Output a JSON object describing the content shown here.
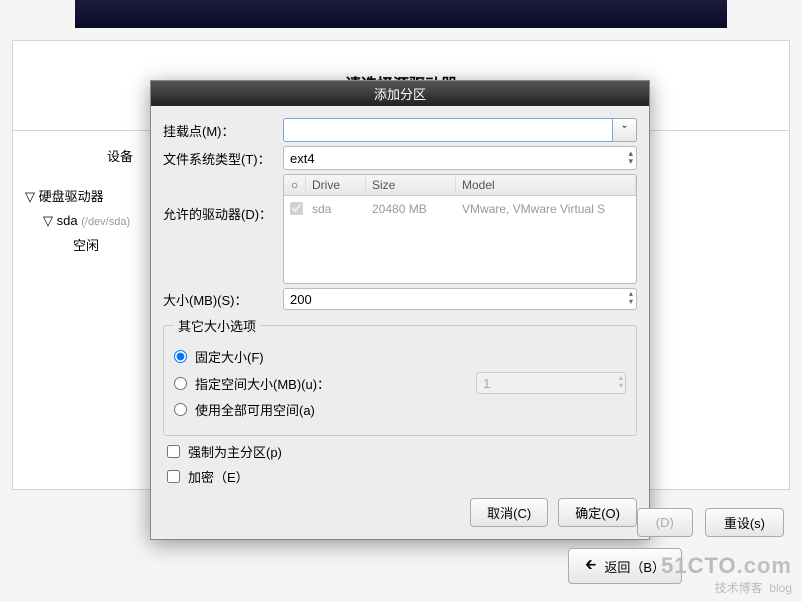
{
  "bg": {
    "title": "请选择源驱动器",
    "tree_header": "设备",
    "tree": {
      "root": "硬盘驱动器",
      "disk": "sda",
      "disk_path": "(/dev/sda)",
      "free": "空闲"
    }
  },
  "dialog": {
    "title": "添加分区",
    "mount_label": "挂载点(M)：",
    "mount_value": "",
    "fs_label": "文件系统类型(T)：",
    "fs_value": "ext4",
    "drives_label": "允许的驱动器(D)：",
    "drive_headers": {
      "drive": "Drive",
      "size": "Size",
      "model": "Model"
    },
    "drive_row": {
      "name": "sda",
      "size": "20480 MB",
      "model": "VMware, VMware Virtual S"
    },
    "size_label": "大小(MB)(S)：",
    "size_value": "200",
    "size_opts": {
      "legend": "其它大小选项",
      "fixed": "固定大小(F)",
      "upto": "指定空间大小(MB)(u)：",
      "upto_value": "1",
      "all": "使用全部可用空间(a)",
      "selected": "fixed"
    },
    "force_primary": "强制为主分区(p)",
    "encrypt": "加密（E）",
    "cancel": "取消(C)",
    "ok": "确定(O)"
  },
  "bottom": {
    "d": "(D)",
    "reset": "重设(s)",
    "back": "返回（B）"
  },
  "watermark": {
    "line1a": "51CTO",
    "line1b": ".com",
    "line2": "技术博客",
    "line2b": "blog"
  }
}
